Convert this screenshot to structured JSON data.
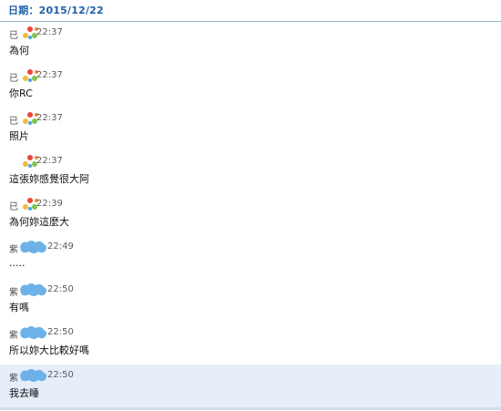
{
  "header": {
    "date": "日期：2015/12/22"
  },
  "messages": [
    {
      "sender": "已",
      "time": "22:37",
      "text": "為何",
      "avatar_icon": "colorful-dots-avatar-icon"
    },
    {
      "sender": "已",
      "time": "22:37",
      "text": "你RC",
      "avatar_icon": "colorful-dots-avatar-icon"
    },
    {
      "sender": "已",
      "time": "22:37",
      "text": "照片",
      "avatar_icon": "colorful-dots-avatar-icon"
    },
    {
      "sender": "",
      "time": "22:37",
      "text": "這張妳感覺很大阿",
      "avatar_icon": "colorful-dots-avatar-icon"
    },
    {
      "sender": "已",
      "time": "22:39",
      "text": "為何妳這麼大",
      "avatar_icon": "colorful-dots-avatar-icon"
    },
    {
      "sender": "紫",
      "time": "22:49",
      "text": ".....",
      "avatar_icon": "blue-blob-avatar-icon"
    },
    {
      "sender": "紫",
      "time": "22:50",
      "text": "有嗎",
      "avatar_icon": "blue-blob-avatar-icon"
    },
    {
      "sender": "紫",
      "time": "22:50",
      "text": "所以妳大比較好嗎",
      "avatar_icon": "blue-blob-avatar-icon"
    },
    {
      "sender": "紫",
      "time": "22:50",
      "text": "我去睡",
      "avatar_icon": "blue-blob-avatar-icon"
    }
  ],
  "colors": {
    "date_header": "#1f5fa8",
    "highlight_row": "#e6eefa"
  }
}
